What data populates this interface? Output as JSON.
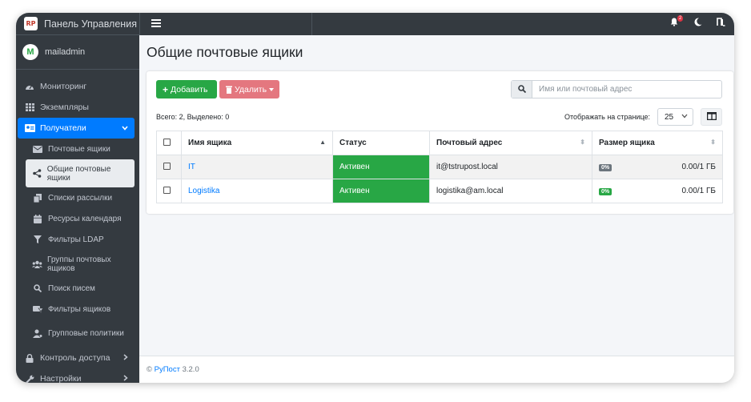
{
  "brand": {
    "logo": "RP",
    "title": "Панель Управления"
  },
  "user": {
    "initial": "M",
    "name": "mailadmin"
  },
  "sidebar": {
    "items": [
      {
        "label": "Мониторинг",
        "icon": "dashboard-icon"
      },
      {
        "label": "Экземпляры",
        "icon": "grid-icon"
      },
      {
        "label": "Получатели",
        "icon": "id-card-icon"
      },
      {
        "label": "Контроль доступа",
        "icon": "lock-icon"
      },
      {
        "label": "Настройки",
        "icon": "wrench-icon"
      }
    ],
    "sub": [
      {
        "label": "Почтовые ящики",
        "icon": "envelope-icon"
      },
      {
        "label": "Общие почтовые ящики",
        "icon": "share-icon"
      },
      {
        "label": "Списки рассылки",
        "icon": "copy-icon"
      },
      {
        "label": "Ресурсы календаря",
        "icon": "calendar-icon"
      },
      {
        "label": "Фильтры LDAP",
        "icon": "filter-icon"
      },
      {
        "label": "Группы почтовых ящиков",
        "icon": "users-icon"
      },
      {
        "label": "Поиск писем",
        "icon": "search-icon"
      },
      {
        "label": "Фильтры ящиков",
        "icon": "mail-filter-icon"
      },
      {
        "label": "Групповые политики",
        "icon": "user-policy-icon"
      }
    ]
  },
  "topbar": {
    "notifications_count": "2"
  },
  "page": {
    "title": "Общие почтовые ящики"
  },
  "toolbar": {
    "add_label": "Добавить",
    "delete_label": "Удалить"
  },
  "search": {
    "placeholder": "Имя или почтовый адрес"
  },
  "summary": "Всего: 2, Выделено: 0",
  "pagination": {
    "per_page_label": "Отображать на странице:",
    "per_page": "25"
  },
  "table": {
    "headers": [
      "Имя ящика",
      "Статус",
      "Почтовый адрес",
      "Размер ящика"
    ],
    "rows": [
      {
        "name": "IT",
        "status": "Активен",
        "email": "it@tstrupost.local",
        "percent": "0%",
        "size": "0.00/1 ГБ"
      },
      {
        "name": "Logistika",
        "status": "Активен",
        "email": "logistika@am.local",
        "percent": "0%",
        "size": "0.00/1 ГБ"
      }
    ]
  },
  "footer": {
    "copyright": "©",
    "product": "РуПост",
    "version": "3.2.0"
  },
  "colors": {
    "sidebar": "#343a40",
    "accent": "#007bff",
    "success": "#28a745",
    "danger": "#e4777f"
  }
}
